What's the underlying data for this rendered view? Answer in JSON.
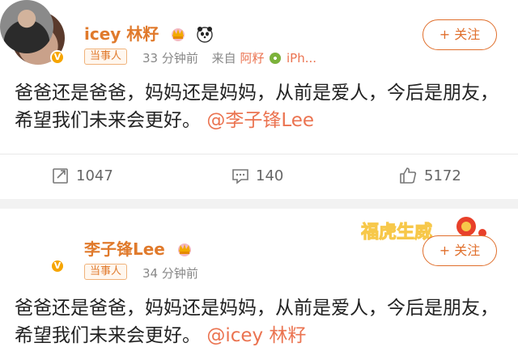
{
  "posts": [
    {
      "author": "icey 林籽",
      "tag": "当事人",
      "time": "33 分钟前",
      "from_prefix": "来自",
      "client": "阿籽",
      "client_suffix": "iPh...",
      "follow_label": "+ 关注",
      "verified_mark": "V",
      "text": "爸爸还是爸爸，妈妈还是妈妈，从前是爱人，今后是朋友，希望我们未来会更好。",
      "mention": "@李子锋Lee",
      "reposts": "1047",
      "comments": "140",
      "likes": "5172"
    },
    {
      "author": "李子锋Lee",
      "tag": "当事人",
      "time": "34 分钟前",
      "follow_label": "+ 关注",
      "verified_mark": "V",
      "text": "爸爸还是爸爸，妈妈还是妈妈，从前是爱人，今后是朋友，希望我们未来会更好。",
      "mention": "@icey 林籽"
    }
  ],
  "decor": {
    "banner_text": "福虎生威"
  },
  "icons": [
    "crown-icon",
    "panda-icon",
    "kiwi-icon",
    "repost-icon",
    "comment-icon",
    "like-icon",
    "verified-icon"
  ],
  "colors": {
    "accent": "#eb7350",
    "name": "#e07a2c",
    "verified": "#f6a500"
  }
}
